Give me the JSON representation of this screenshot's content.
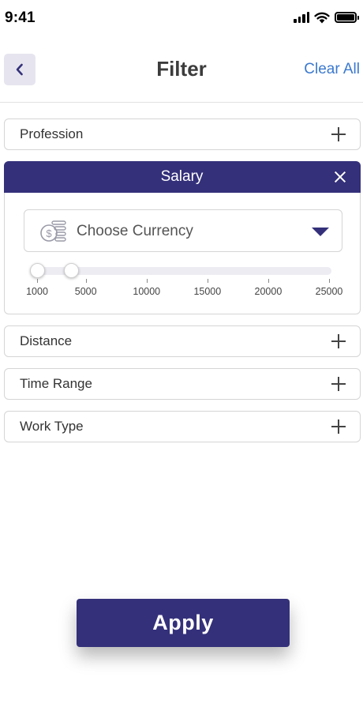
{
  "status_bar": {
    "time": "9:41",
    "icons": [
      "signal-icon",
      "wifi-icon",
      "battery-icon"
    ]
  },
  "header": {
    "back_icon": "chevron-left-icon",
    "title": "Filter",
    "clear_all": "Clear All"
  },
  "filters": {
    "profession": "Profession",
    "salary": {
      "title": "Salary",
      "currency_placeholder": "Choose Currency",
      "currency_icon": "coins-currency-icon",
      "slider": {
        "min_value": 1000,
        "max_value": 25000,
        "selected_low": 1000,
        "selected_high": 2000,
        "ticks": [
          "1000",
          "5000",
          "10000",
          "15000",
          "20000",
          "25000"
        ]
      }
    },
    "distance": "Distance",
    "time_range": "Time Range",
    "work_type": "Work Type"
  },
  "actions": {
    "apply": "Apply"
  },
  "colors": {
    "primary": "#34307a",
    "link": "#3b79cf",
    "back_button_bg": "#e6e5ef",
    "border": "#d5d5d5"
  }
}
